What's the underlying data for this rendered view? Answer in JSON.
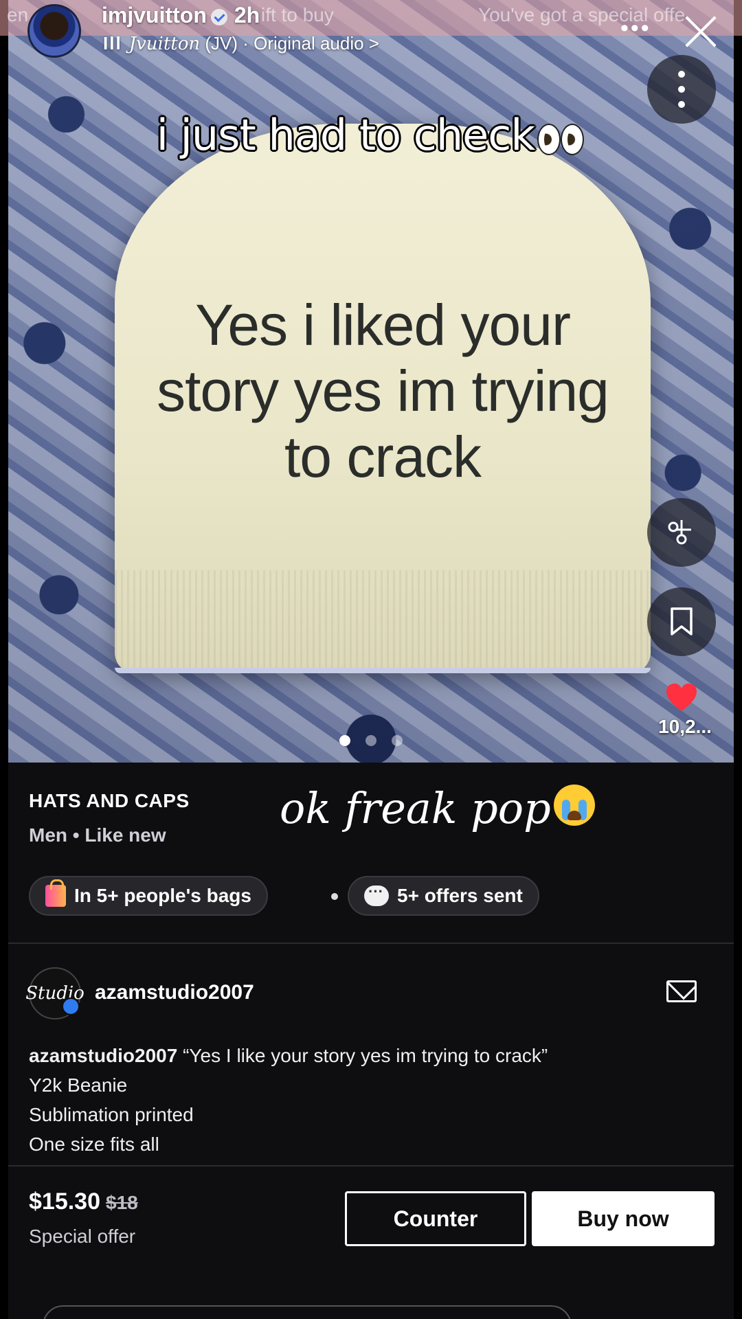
{
  "header": {
    "username": "imjvuitton",
    "time": "2h",
    "audio_bars": "Ill",
    "audio_artist": "Jvuitton",
    "audio_suffix": "(JV) · Original audio >",
    "strip_left": "en",
    "strip_middle": "ift to buy",
    "strip_right": "You've got a special offe"
  },
  "overlay": {
    "caption": "i just had to check",
    "beanie_text": "Yes i liked your story yes im trying to crack",
    "reaction": "ok freak pop"
  },
  "actions": {
    "like_count": "10,2..."
  },
  "carousel": {
    "count": 3,
    "active": 0
  },
  "listing": {
    "category": "HATS AND CAPS",
    "meta": "Men • Like new",
    "bags_pill": "In 5+ people's bags",
    "offers_pill": "5+ offers sent",
    "seller_avatar": "Studio",
    "seller": "azamstudio2007",
    "desc_user": "azamstudio2007",
    "desc_quote": "“Yes I like your story yes im trying to crack”",
    "desc_line2": "Y2k Beanie",
    "desc_line3": "Sublimation printed",
    "desc_line4": "One size fits all",
    "price": "$15.30",
    "old_price": "$18",
    "offer_label": "Special offer",
    "counter_label": "Counter",
    "buy_label": "Buy now"
  },
  "colors": {
    "background": "#0e0e11",
    "like": "#ff3040",
    "verified": "#2f7cf0"
  }
}
